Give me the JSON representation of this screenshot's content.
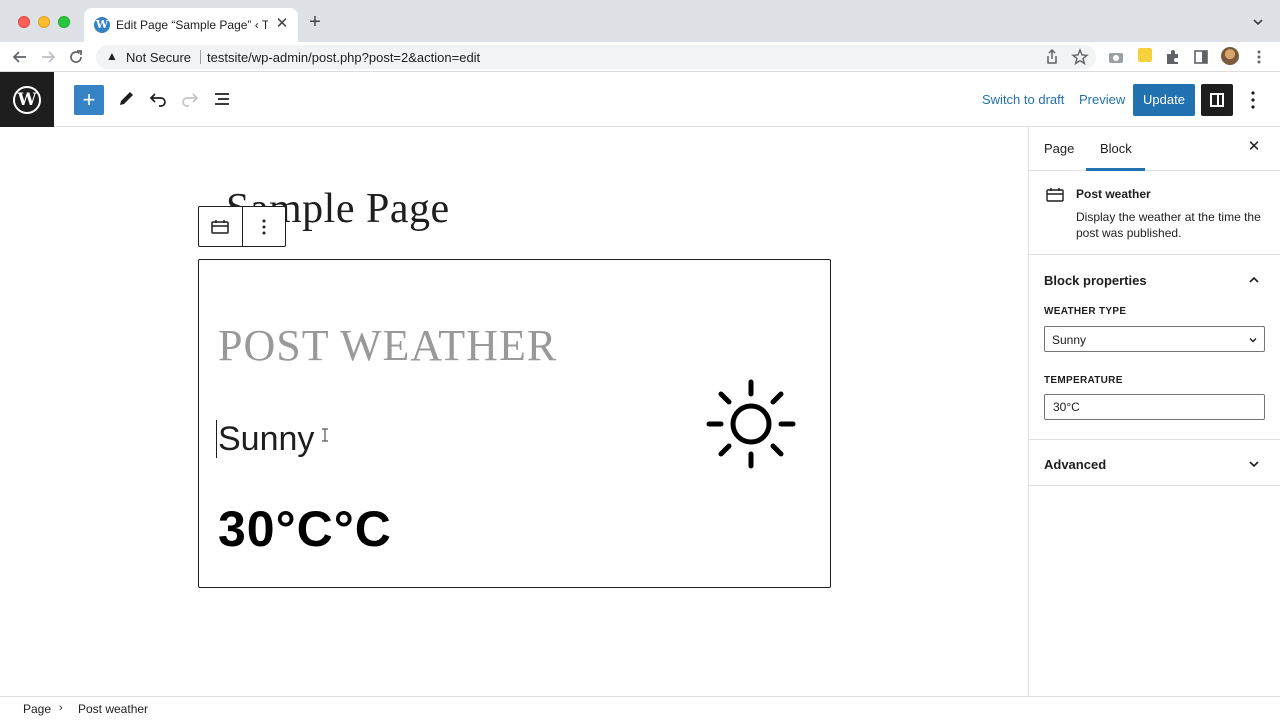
{
  "browser": {
    "tab_title": "Edit Page “Sample Page” ‹ Testsite — WordPress",
    "security_label": "Not Secure",
    "url": "testsite/wp-admin/post.php?post=2&action=edit"
  },
  "header": {
    "switch_to_draft": "Switch to draft",
    "preview": "Preview",
    "update": "Update",
    "accent_color": "#2271b1"
  },
  "canvas": {
    "page_title": "Sample Page",
    "block": {
      "heading": "POST WEATHER",
      "weather_type": "Sunny",
      "temperature": "30°C°C",
      "icon": "sun-icon"
    }
  },
  "sidebar": {
    "tabs": [
      {
        "label": "Page",
        "active": false
      },
      {
        "label": "Block",
        "active": true
      }
    ],
    "block_card": {
      "title": "Post weather",
      "description": "Display the weather at the time the post was published."
    },
    "panels": {
      "block_properties": {
        "title": "Block properties",
        "weather_type_label": "WEATHER TYPE",
        "weather_type_value": "Sunny",
        "temperature_label": "TEMPERATURE",
        "temperature_value": "30°C"
      },
      "advanced": {
        "title": "Advanced"
      }
    }
  },
  "footer": {
    "breadcrumb": [
      "Page",
      "Post weather"
    ]
  }
}
